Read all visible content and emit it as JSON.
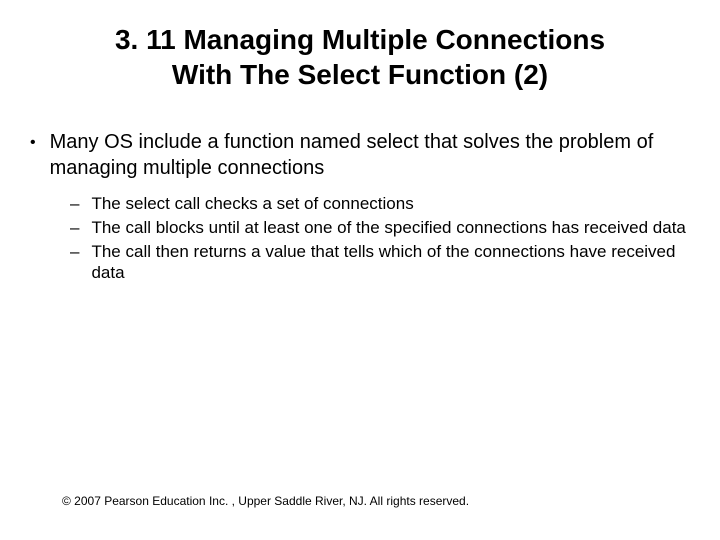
{
  "slide": {
    "title_line1": "3. 11 Managing Multiple Connections",
    "title_line2": "With The Select Function (2)",
    "bullets": [
      {
        "text": "Many OS include a function named select that solves the problem of managing multiple connections",
        "sub": [
          "The  select  call checks a set of connections",
          "The call blocks until at least one of the specified connections has received data",
          "The call then returns a value that tells which of the connections have received data"
        ]
      }
    ],
    "footer": "© 2007 Pearson Education Inc. , Upper Saddle River, NJ. All rights reserved."
  }
}
